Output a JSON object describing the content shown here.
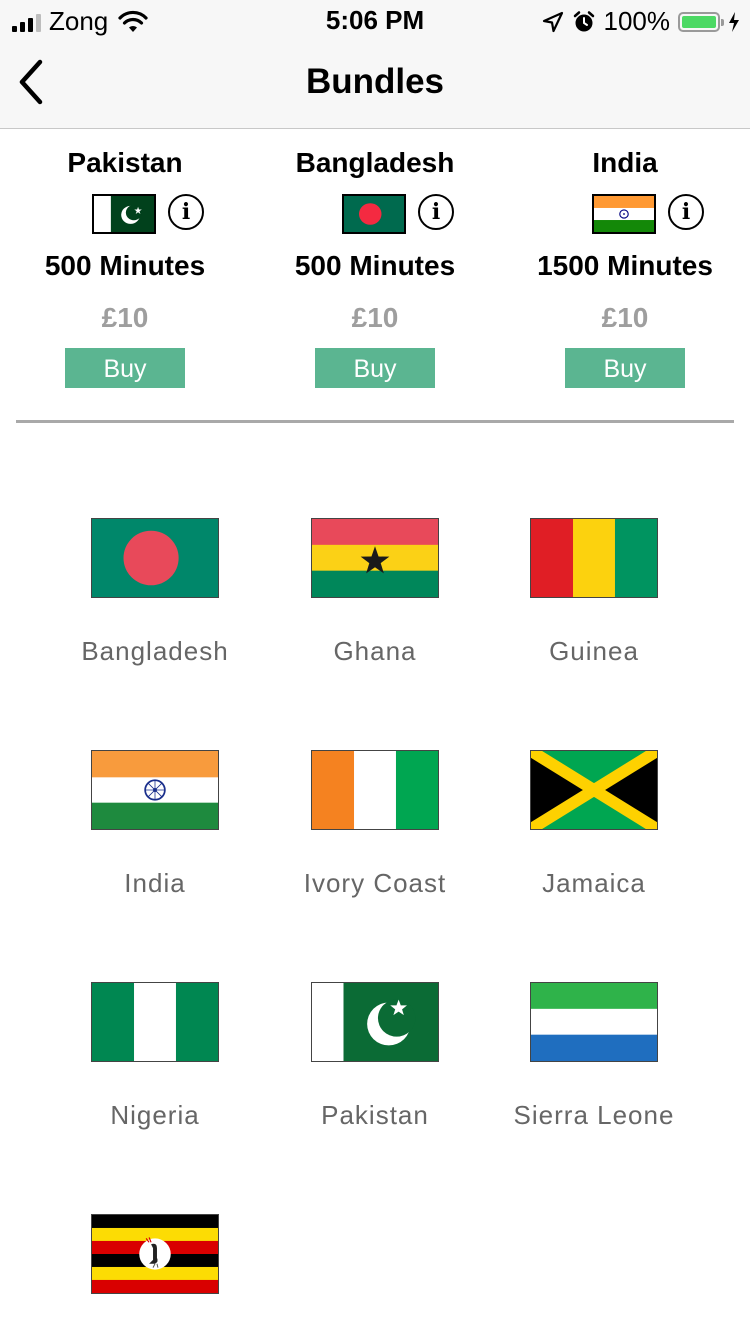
{
  "status": {
    "carrier": "Zong",
    "time": "5:06 PM",
    "battery": "100%",
    "battery_level": 1.0
  },
  "nav": {
    "title": "Bundles",
    "back_icon": "chevron-left-icon"
  },
  "bundles": [
    {
      "country": "Pakistan",
      "flag": "pakistan-flag-icon",
      "minutes": "500 Minutes",
      "price": "£10",
      "buy": "Buy"
    },
    {
      "country": "Bangladesh",
      "flag": "bangladesh-flag-icon",
      "minutes": "500 Minutes",
      "price": "£10",
      "buy": "Buy"
    },
    {
      "country": "India",
      "flag": "india-flag-icon",
      "minutes": "1500 Minutes",
      "price": "£10",
      "buy": "Buy"
    }
  ],
  "countries": [
    {
      "name": "Bangladesh",
      "flag": "bangladesh-flag-icon"
    },
    {
      "name": "Ghana",
      "flag": "ghana-flag-icon"
    },
    {
      "name": "Guinea",
      "flag": "guinea-flag-icon"
    },
    {
      "name": "India",
      "flag": "india-flag-icon"
    },
    {
      "name": "Ivory Coast",
      "flag": "ivory-coast-flag-icon"
    },
    {
      "name": "Jamaica",
      "flag": "jamaica-flag-icon"
    },
    {
      "name": "Nigeria",
      "flag": "nigeria-flag-icon"
    },
    {
      "name": "Pakistan",
      "flag": "pakistan-flag-icon"
    },
    {
      "name": "Sierra Leone",
      "flag": "sierra-leone-flag-icon"
    },
    {
      "name": "",
      "flag": "uganda-flag-icon"
    }
  ],
  "colors": {
    "buy_button": "#5bb591",
    "price": "#9e9e9e",
    "battery": "#4cd964",
    "divider": "#a9a9a9"
  }
}
